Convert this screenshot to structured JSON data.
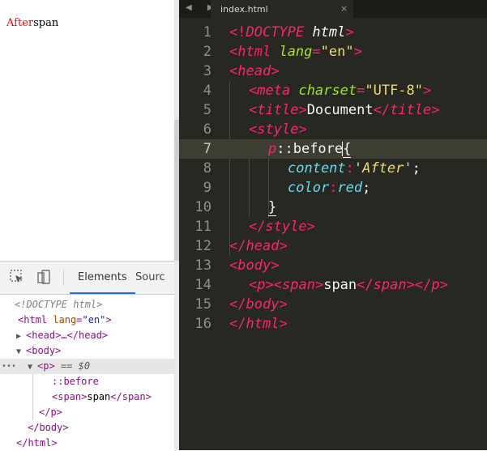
{
  "rendered": {
    "before_text": "After",
    "span_text": "span"
  },
  "devtools": {
    "tabs": [
      "Elements",
      "Sourc"
    ],
    "dom": {
      "doctype": "<!DOCTYPE html>",
      "html_open_tag": "<html",
      "lang_attr": "lang",
      "lang_value": "\"en\"",
      "html_close_bracket": ">",
      "head_collapsed": "<head>…</head>",
      "body_open": "<body>",
      "p_open": "<p>",
      "eq0": "== $0",
      "before_pseudo": "::before",
      "span_open": "<span>",
      "span_text": "span",
      "span_close": "</span>",
      "p_close": "</p>",
      "body_close": "</body>",
      "html_close": "</html>",
      "dots": "•••"
    }
  },
  "editor": {
    "file_tab": "index.html",
    "close_glyph": "×",
    "nav_arrows": "◀ ▶",
    "line_numbers": [
      "1",
      "2",
      "3",
      "4",
      "5",
      "6",
      "7",
      "8",
      "9",
      "10",
      "11",
      "12",
      "13",
      "14",
      "15",
      "16"
    ],
    "current_line": 7,
    "code": {
      "l1": [
        "<!",
        "DOCTYPE",
        " html",
        ">"
      ],
      "l2": [
        "<",
        "html",
        " ",
        "lang",
        "=",
        "\"en\"",
        ">"
      ],
      "l3": [
        "<",
        "head",
        ">"
      ],
      "l4": [
        "<",
        "meta",
        " ",
        "charset",
        "=",
        "\"UTF-8\"",
        ">"
      ],
      "l5": [
        "<",
        "title",
        ">",
        "Document",
        "</",
        "title",
        ">"
      ],
      "l6": [
        "<",
        "style",
        ">"
      ],
      "l7": [
        "p",
        "::before",
        "{"
      ],
      "l8": [
        "content",
        ":",
        "'After'",
        ";"
      ],
      "l9": [
        "color",
        ":",
        "red",
        ";"
      ],
      "l10": [
        "}"
      ],
      "l11": [
        "</",
        "style",
        ">"
      ],
      "l12": [
        "</",
        "head",
        ">"
      ],
      "l13": [
        "<",
        "body",
        ">"
      ],
      "l14": [
        "<",
        "p",
        ">",
        "<",
        "span",
        ">",
        "span",
        "</",
        "span",
        ">",
        "</",
        "p",
        ">"
      ],
      "l15": [
        "</",
        "body",
        ">"
      ],
      "l16": [
        "</",
        "html",
        ">"
      ]
    }
  },
  "colors": {
    "editor_bg": "#272822",
    "keyword": "#f92672",
    "attribute": "#a6e22e",
    "string": "#e6db74",
    "property": "#66d9ef",
    "before_red": "#ff0000"
  }
}
